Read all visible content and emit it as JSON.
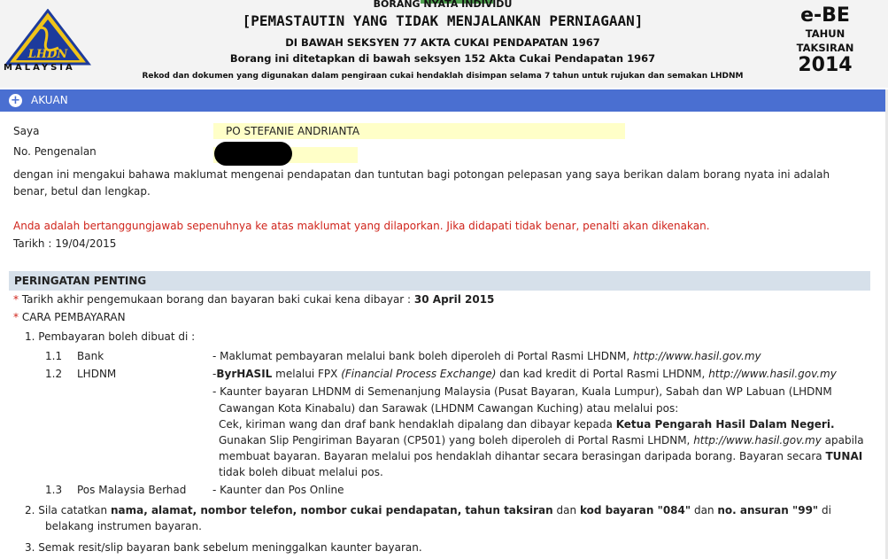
{
  "header": {
    "top_line": "BORANG NYATA INDIVIDU",
    "title": "[PEMASTAUTIN YANG TIDAK MENJALANKAN PERNIAGAAN]",
    "sub1": "DI BAWAH SEKSYEN 77 AKTA CUKAI PENDAPATAN 1967",
    "sub2": "Borang ini ditetapkan di bawah seksyen 152 Akta Cukai Pendapatan 1967",
    "note": "Rekod dan dokumen yang digunakan dalam pengiraan cukai hendaklah disimpan selama 7 tahun untuk rujukan dan semakan LHDNM",
    "logo_text": "LHDN",
    "logo_word": "MALAYSIA",
    "form_code": "e-BE",
    "tahun": "TAHUN",
    "taksiran": "TAKSIRAN",
    "year": "2014"
  },
  "section": {
    "label": "AKUAN",
    "icon": "plus-circle-icon"
  },
  "akuan": {
    "saya_label": "Saya",
    "saya_value": "PO STEFANIE ANDRIANTA",
    "id_label": "No. Pengenalan",
    "declaration": "dengan ini mengakui bahawa maklumat mengenai pendapatan dan tuntutan bagi potongan pelepasan yang saya berikan dalam borang nyata ini adalah benar, betul dan lengkap.",
    "warning": "Anda adalah bertanggungjawab sepenuhnya ke atas maklumat yang dilaporkan. Jika didapati tidak benar, penalti akan dikenakan.",
    "tarikh": "Tarikh : 19/04/2015"
  },
  "peringatan": {
    "title": "PERINGATAN PENTING",
    "deadline_text": "Tarikh akhir pengemukaan borang dan bayaran baki cukai kena dibayar :",
    "deadline_date": "30 April 2015",
    "cara": "CARA PEMBAYARAN",
    "item1": "1.  Pembayaran boleh dibuat di :",
    "r11_num": "1.1",
    "r11_label": "Bank",
    "r11_text": "- Maklumat pembayaran melalui bank boleh diperoleh di Portal Rasmi LHDNM,",
    "url": "http://www.hasil.gov.my",
    "r12_num": "1.2",
    "r12_label": "LHDNM",
    "r12_byr": "ByrHASIL",
    "r12_text_a": "melalui FPX",
    "r12_fpx": "(Financial Process Exchange)",
    "r12_text_b": "dan kad kredit di Portal Rasmi LHDNM,",
    "r12b_l1": "- Kaunter bayaran LHDNM di Semenanjung Malaysia (Pusat Bayaran, Kuala Lumpur), Sabah dan WP Labuan (LHDNM",
    "r12b_l2": "Cawangan Kota Kinabalu) dan Sarawak (LHDNM Cawangan Kuching) atau melalui pos:",
    "r12b_l3a": "Cek, kiriman wang dan draf bank hendaklah dipalang dan dibayar kepada",
    "r12b_l3b": "Ketua Pengarah Hasil Dalam Negeri.",
    "r12b_l4a": "Gunakan Slip Pengiriman Bayaran (CP501) yang boleh diperoleh di Portal Rasmi LHDNM,",
    "r12b_l4b": "apabila",
    "r12b_l5a": "membuat bayaran. Bayaran melalui pos hendaklah dihantar secara berasingan daripada borang. Bayaran secara",
    "r12b_l5b": "TUNAI",
    "r12b_l6": "tidak boleh dibuat melalui pos.",
    "r13_num": "1.3",
    "r13_label": "Pos Malaysia Berhad",
    "r13_text": "- Kaunter dan Pos Online",
    "item2_a": "2.  Sila catatkan",
    "item2_b": "nama, alamat, nombor telefon, nombor cukai pendapatan, tahun taksiran",
    "item2_c": "dan",
    "item2_d": "kod bayaran \"084\"",
    "item2_e": "dan",
    "item2_f": "no. ansuran \"99\"",
    "item2_g": "di",
    "item2_l2": "belakang instrumen bayaran.",
    "item3": "3.  Semak resit/slip bayaran bank sebelum meninggalkan kaunter bayaran."
  }
}
